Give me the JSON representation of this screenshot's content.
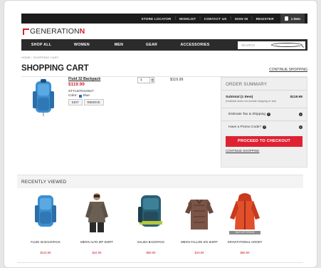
{
  "utility_bar": {
    "links": [
      "STORE LOCATOR",
      "WISHLIST",
      "CONTACT US",
      "SIGN IN",
      "REGISTER"
    ],
    "cart_label": "1 Item"
  },
  "brand": {
    "name_prefix": "GENERATION",
    "name_suffix": "N"
  },
  "nav": {
    "items": [
      "SHOP ALL",
      "WOMEN",
      "MEN",
      "GEAR",
      "ACCESSORIES"
    ],
    "search_placeholder": "SEARCH"
  },
  "breadcrumb": "HOME  /  SHOPPING CART",
  "page": {
    "title": "SHOPPING CART",
    "continue_shopping": "CONTINUE SHOPPING"
  },
  "cart_item": {
    "name": "Fluid 32 Backpack",
    "price": "$119.99",
    "style": "STYLE#OU4527",
    "color_label": "Color:",
    "color_value": "blue",
    "edit_label": "EDIT",
    "remove_label": "REMOVE",
    "quantity": "1",
    "line_total": "$119.99"
  },
  "order_summary": {
    "title": "ORDER SUMMARY",
    "subtotal_label": "Subtotal (1 Item)",
    "subtotal_value": "$119.99",
    "subtotal_note": "(Subtotal does not include shipping or tax)",
    "tax_label": "Estimate Tax & Shipping",
    "promo_label": "Have a Promo Code?",
    "checkout_label": "PROCEED TO CHECKOUT",
    "continue_label": "CONTINUE SHOPPING"
  },
  "recently_viewed": {
    "title": "RECENTLY VIEWED",
    "items": [
      {
        "name": "FLUID 32 BACKPACK",
        "price": "$119.99"
      },
      {
        "name": "MEN'S ALTO ZIP SHIRT",
        "price": "$34.99"
      },
      {
        "name": "SALIDA BACKPACK",
        "price": "$99.99"
      },
      {
        "name": "MEN'S FALLON S/S SHIRT",
        "price": "$19.99"
      },
      {
        "name": "GRAVITATIONAL HOODY",
        "price": "$89.99",
        "badge": "OUT OF STOCK"
      }
    ]
  },
  "colors": {
    "accent": "#de2232",
    "nav_bg": "#2b2b2b",
    "util_bg": "#1c1c1c"
  }
}
